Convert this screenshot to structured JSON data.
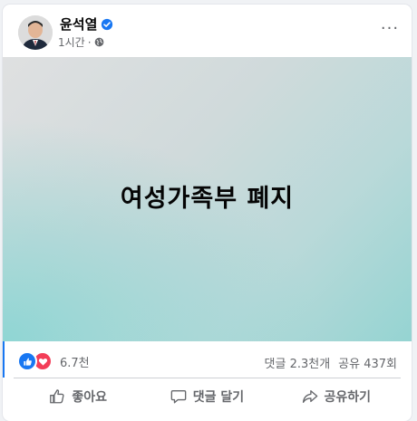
{
  "post": {
    "author": "윤석열",
    "time": "1시간",
    "time_sep": "·",
    "body_text": "여성가족부 폐지",
    "more_label": "···"
  },
  "stats": {
    "reaction_count": "6.7천",
    "comments": "댓글 2.3천개",
    "shares": "공유 437회"
  },
  "actions": {
    "like_label": "좋아요",
    "comment_label": "댓글 달기",
    "share_label": "공유하기"
  },
  "colors": {
    "brand_blue": "#1877f2",
    "love_red": "#f33e58",
    "secondary_text": "#65676b"
  },
  "icons": {
    "verified": "verified-badge-icon",
    "privacy": "globe-icon",
    "like": "thumbs-up-icon",
    "comment": "comment-bubble-icon",
    "share": "share-arrow-icon"
  }
}
